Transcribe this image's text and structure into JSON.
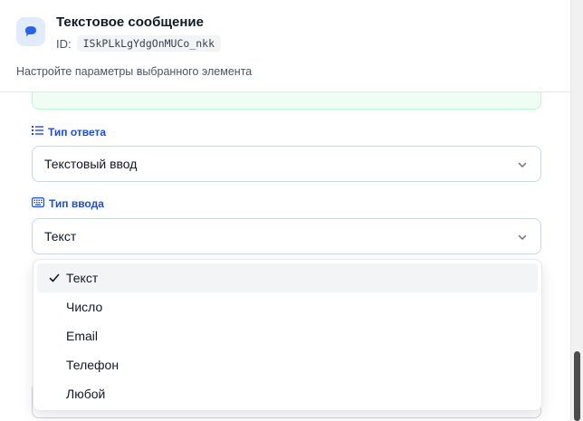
{
  "header": {
    "title": "Текстовое сообщение",
    "id_label": "ID:",
    "id_value": "ISkPLkLgYdgOnMUCo_nkk",
    "description": "Настройте параметры выбранного элемента",
    "icon": "chat-bubble-icon"
  },
  "fields": {
    "answer_type": {
      "label": "Тип ответа",
      "icon": "list-icon",
      "value": "Текстовый ввод"
    },
    "input_type": {
      "label": "Тип ввода",
      "icon": "keyboard-icon",
      "value": "Текст"
    }
  },
  "dropdown": {
    "selected": "Текст",
    "options": [
      "Текст",
      "Число",
      "Email",
      "Телефон",
      "Любой"
    ]
  },
  "colors": {
    "accent": "#1d4ed8",
    "icon_bg": "#e0ecfb",
    "success_bg": "#f0fdf4"
  }
}
